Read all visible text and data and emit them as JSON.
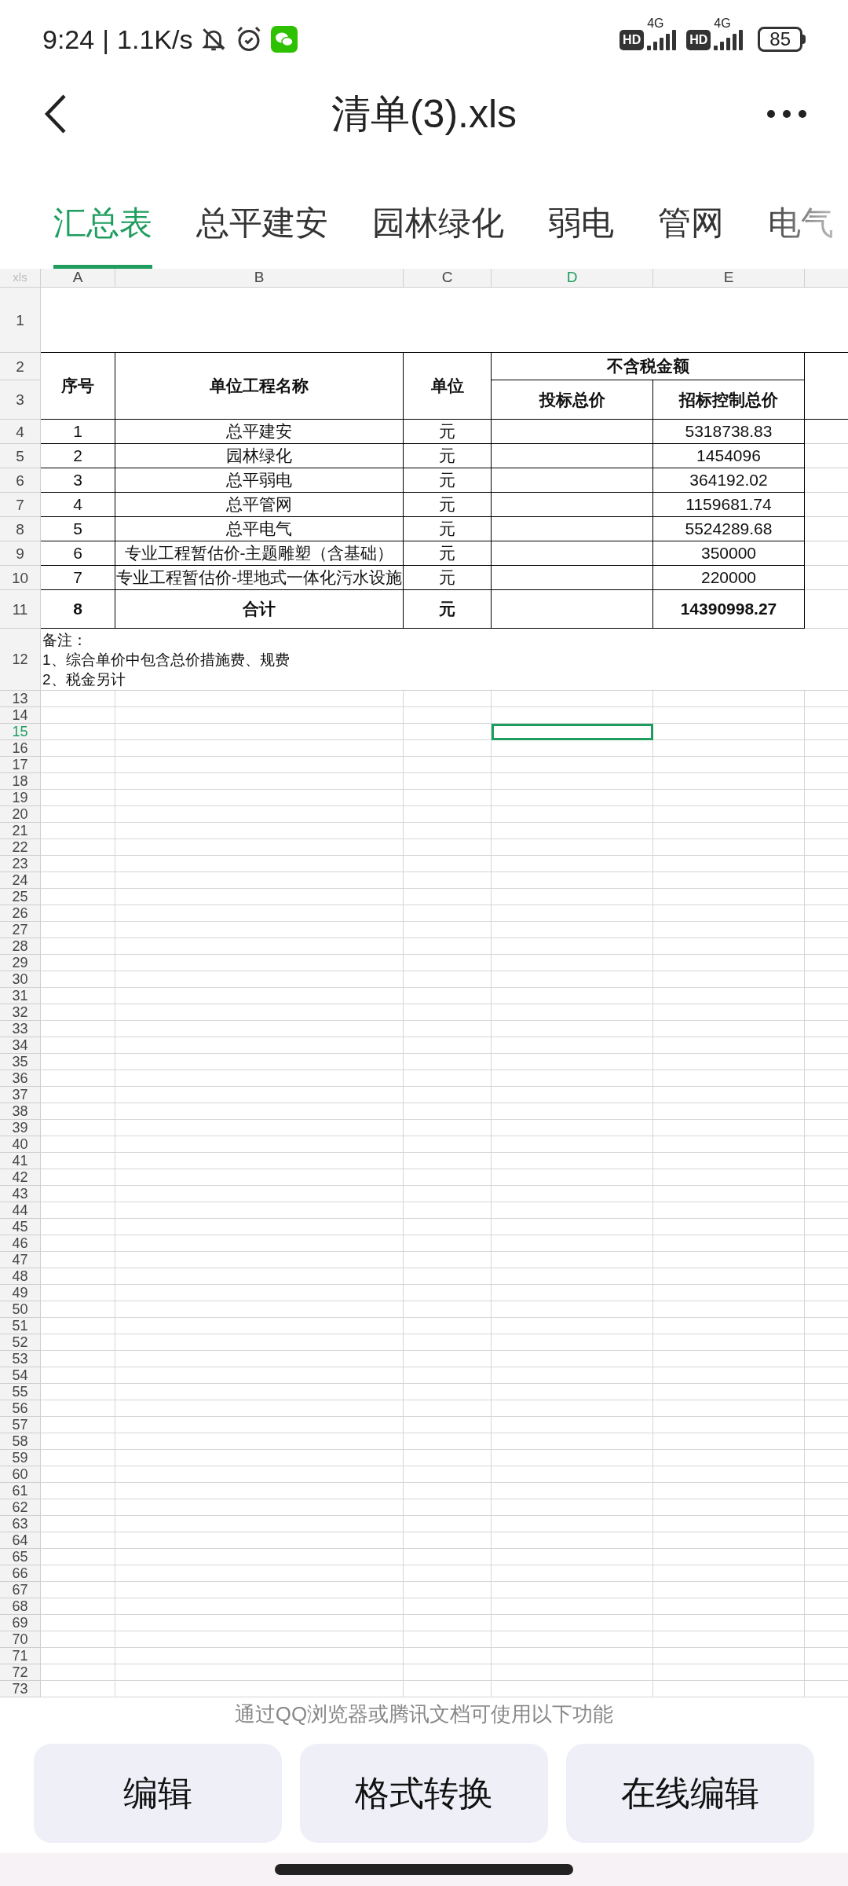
{
  "status_bar": {
    "time": "9:24",
    "separator": "|",
    "network_speed": "1.1K/s",
    "sim_1": {
      "hd": "HD",
      "network": "4G"
    },
    "sim_2": {
      "hd": "HD",
      "network": "4G"
    },
    "battery": "85"
  },
  "title": "清单(3).xls",
  "tabs": [
    {
      "label": "汇总表",
      "selected": true
    },
    {
      "label": "总平建安",
      "selected": false
    },
    {
      "label": "园林绿化",
      "selected": false
    },
    {
      "label": "弱电",
      "selected": false
    },
    {
      "label": "管网",
      "selected": false
    },
    {
      "label": "电气",
      "selected": false
    }
  ],
  "sheet": {
    "corner": "xls",
    "columns": [
      {
        "label": "A",
        "selected": false
      },
      {
        "label": "B",
        "selected": false
      },
      {
        "label": "C",
        "selected": false
      },
      {
        "label": "D",
        "selected": true
      },
      {
        "label": "E",
        "selected": false
      }
    ],
    "header": {
      "index": "序号",
      "name": "单位工程名称",
      "unit": "单位",
      "group": "不含税金额",
      "bid_total": "投标总价",
      "control_total": "招标控制总价"
    },
    "items": [
      {
        "index": "1",
        "name": "总平建安",
        "unit": "元",
        "control_total": "5318738.83"
      },
      {
        "index": "2",
        "name": "园林绿化",
        "unit": "元",
        "control_total": "1454096"
      },
      {
        "index": "3",
        "name": "总平弱电",
        "unit": "元",
        "control_total": "364192.02"
      },
      {
        "index": "4",
        "name": "总平管网",
        "unit": "元",
        "control_total": "1159681.74"
      },
      {
        "index": "5",
        "name": "总平电气",
        "unit": "元",
        "control_total": "5524289.68"
      },
      {
        "index": "6",
        "name": "专业工程暂估价-主题雕塑（含基础）",
        "unit": "元",
        "control_total": "350000"
      },
      {
        "index": "7",
        "name": "专业工程暂估价-埋地式一体化污水设施",
        "unit": "元",
        "control_total": "220000"
      }
    ],
    "total": {
      "index": "8",
      "name": "合计",
      "unit": "元",
      "control_total": "14390998.27"
    },
    "note": [
      "备注：",
      "1、综合单价中包含总价措施费、规费",
      "2、税金另计"
    ],
    "row_numbers": [
      {
        "label": "1",
        "selected": false
      },
      {
        "label": "2",
        "selected": false
      },
      {
        "label": "3",
        "selected": false
      },
      {
        "label": "4",
        "selected": false
      },
      {
        "label": "5",
        "selected": false
      },
      {
        "label": "6",
        "selected": false
      },
      {
        "label": "7",
        "selected": false
      },
      {
        "label": "8",
        "selected": false
      },
      {
        "label": "9",
        "selected": false
      },
      {
        "label": "10",
        "selected": false
      },
      {
        "label": "11",
        "selected": false
      },
      {
        "label": "12",
        "selected": false
      },
      {
        "label": "13",
        "selected": false
      },
      {
        "label": "14",
        "selected": false
      },
      {
        "label": "15",
        "selected": true
      },
      {
        "label": "16",
        "selected": false
      },
      {
        "label": "17",
        "selected": false
      },
      {
        "label": "18",
        "selected": false
      },
      {
        "label": "19",
        "selected": false
      },
      {
        "label": "20",
        "selected": false
      },
      {
        "label": "21",
        "selected": false
      },
      {
        "label": "22",
        "selected": false
      },
      {
        "label": "23",
        "selected": false
      },
      {
        "label": "24",
        "selected": false
      },
      {
        "label": "25",
        "selected": false
      },
      {
        "label": "26",
        "selected": false
      },
      {
        "label": "27",
        "selected": false
      },
      {
        "label": "28",
        "selected": false
      },
      {
        "label": "29",
        "selected": false
      },
      {
        "label": "30",
        "selected": false
      },
      {
        "label": "31",
        "selected": false
      },
      {
        "label": "32",
        "selected": false
      },
      {
        "label": "33",
        "selected": false
      },
      {
        "label": "34",
        "selected": false
      },
      {
        "label": "35",
        "selected": false
      },
      {
        "label": "36",
        "selected": false
      },
      {
        "label": "37",
        "selected": false
      },
      {
        "label": "38",
        "selected": false
      },
      {
        "label": "39",
        "selected": false
      },
      {
        "label": "40",
        "selected": false
      },
      {
        "label": "41",
        "selected": false
      },
      {
        "label": "42",
        "selected": false
      },
      {
        "label": "43",
        "selected": false
      },
      {
        "label": "44",
        "selected": false
      },
      {
        "label": "45",
        "selected": false
      },
      {
        "label": "46",
        "selected": false
      },
      {
        "label": "47",
        "selected": false
      },
      {
        "label": "48",
        "selected": false
      },
      {
        "label": "49",
        "selected": false
      },
      {
        "label": "50",
        "selected": false
      },
      {
        "label": "51",
        "selected": false
      },
      {
        "label": "52",
        "selected": false
      },
      {
        "label": "53",
        "selected": false
      },
      {
        "label": "54",
        "selected": false
      },
      {
        "label": "55",
        "selected": false
      },
      {
        "label": "56",
        "selected": false
      },
      {
        "label": "57",
        "selected": false
      },
      {
        "label": "58",
        "selected": false
      },
      {
        "label": "59",
        "selected": false
      },
      {
        "label": "60",
        "selected": false
      },
      {
        "label": "61",
        "selected": false
      },
      {
        "label": "62",
        "selected": false
      },
      {
        "label": "63",
        "selected": false
      },
      {
        "label": "64",
        "selected": false
      },
      {
        "label": "65",
        "selected": false
      },
      {
        "label": "66",
        "selected": false
      },
      {
        "label": "67",
        "selected": false
      },
      {
        "label": "68",
        "selected": false
      },
      {
        "label": "69",
        "selected": false
      },
      {
        "label": "70",
        "selected": false
      },
      {
        "label": "71",
        "selected": false
      },
      {
        "label": "72",
        "selected": false
      },
      {
        "label": "73",
        "selected": false
      }
    ]
  },
  "bottom_panel": {
    "hint": "通过QQ浏览器或腾讯文档可使用以下功能",
    "buttons": [
      "编辑",
      "格式转换",
      "在线编辑"
    ]
  }
}
